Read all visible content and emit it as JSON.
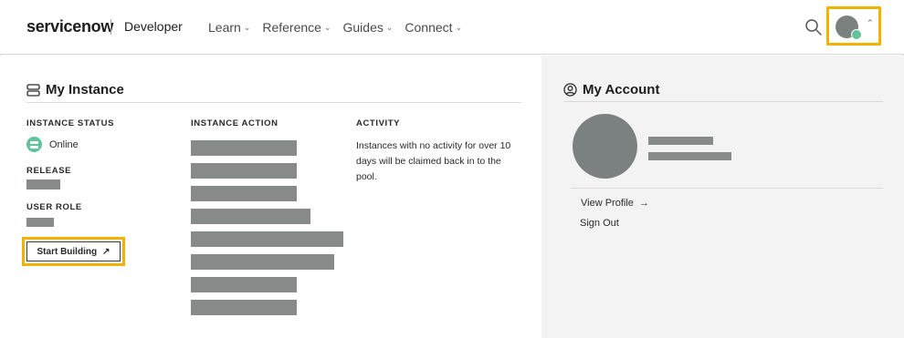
{
  "header": {
    "logo_text": "servicenow",
    "product_label": "Developer",
    "nav": [
      {
        "label": "Learn"
      },
      {
        "label": "Reference"
      },
      {
        "label": "Guides"
      },
      {
        "label": "Connect"
      }
    ],
    "icons": [
      "search-icon",
      "avatar",
      "chevron-up-icon"
    ],
    "highlight_color": "#f0b400"
  },
  "instance": {
    "title": "My Instance",
    "status_label": "INSTANCE STATUS",
    "status_value": "Online",
    "status_color": "#62c29a",
    "release_label": "RELEASE",
    "role_label": "USER ROLE",
    "action_label": "INSTANCE ACTION",
    "activity_label": "ACTIVITY",
    "activity_text": "Instances with no activity for over 10 days will be claimed back in to the pool.",
    "start_button": "Start Building",
    "start_button_icon": "↗",
    "redacted_action_count": 8
  },
  "account": {
    "title": "My Account",
    "view_profile": "View Profile",
    "view_profile_icon": "→",
    "sign_out": "Sign Out"
  }
}
